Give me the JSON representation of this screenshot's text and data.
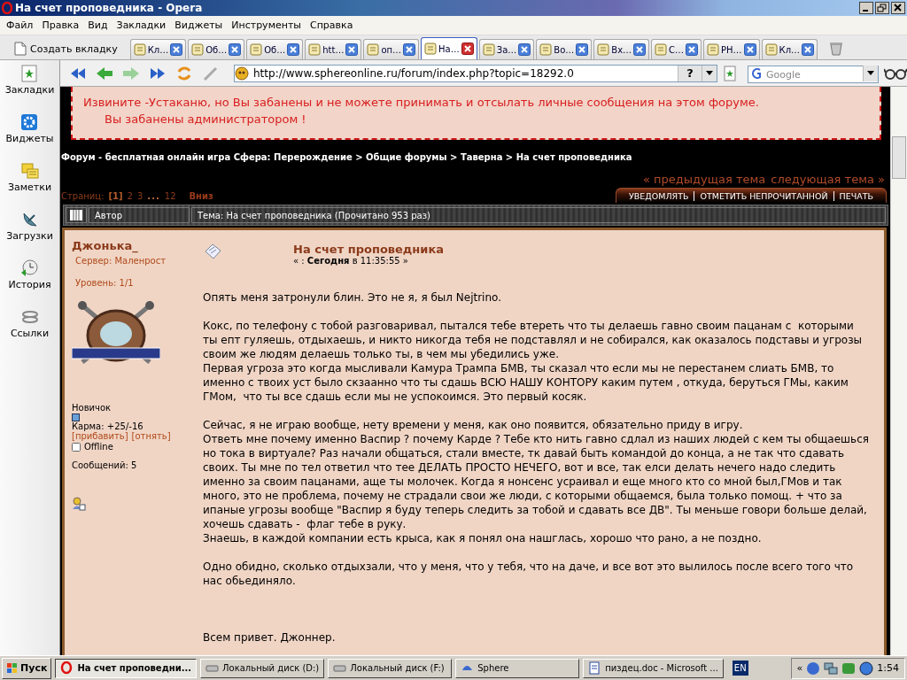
{
  "window": {
    "title": "На счет проповедника - Opera"
  },
  "menu": [
    "Файл",
    "Правка",
    "Вид",
    "Закладки",
    "Виджеты",
    "Инструменты",
    "Справка"
  ],
  "new_tab": "Создать вкладку",
  "tabs": [
    {
      "label": "Кл…",
      "selected": false
    },
    {
      "label": "Об…",
      "selected": false
    },
    {
      "label": "Об…",
      "selected": false
    },
    {
      "label": "htt…",
      "selected": false
    },
    {
      "label": "оп…",
      "selected": false
    },
    {
      "label": "На…",
      "selected": true
    },
    {
      "label": "За…",
      "selected": false
    },
    {
      "label": "Во…",
      "selected": false
    },
    {
      "label": "Вх…",
      "selected": false
    },
    {
      "label": "С…",
      "selected": false
    },
    {
      "label": "PH…",
      "selected": false
    },
    {
      "label": "Кл…",
      "selected": false
    }
  ],
  "address": "http://www.sphereonline.ru/forum/index.php?topic=18292.0",
  "address_help": "?",
  "search": {
    "placeholder": "Google"
  },
  "sidebar": {
    "items": [
      "Закладки",
      "Виджеты",
      "Заметки",
      "Загрузки",
      "История",
      "Ссылки"
    ]
  },
  "forum": {
    "ban_notice": [
      "Извините -Устаканю, но Вы забанены и не можете принимать и отсылать личные сообщения на этом форуме.",
      "Вы забанены администратором !"
    ],
    "breadcrumb": "Форум - бесплатная онлайн игра Сфера: Перерождение > Общие форумы > Таверна > На счет проповедника",
    "topic_nav": [
      "« предыдущая тема",
      "следующая тема »"
    ],
    "pages_label": "Страниц:",
    "pages": [
      {
        "label": "[1]",
        "kind": "page",
        "selected": true
      },
      {
        "label": "2",
        "kind": "page",
        "selected": false
      },
      {
        "label": "3",
        "kind": "page",
        "selected": false
      },
      {
        "label": "...",
        "kind": "gap",
        "selected": false
      },
      {
        "label": "12",
        "kind": "page",
        "selected": false
      }
    ],
    "go_down": "Вниз",
    "actions": [
      "УВЕДОМЛЯТЬ",
      "ОТМЕТИТЬ НЕПРОЧИТАННОЙ",
      "ПЕЧАТЬ"
    ],
    "header": {
      "author": "Автор",
      "topic": "Тема: На счет проповедника  (Прочитано 953 раз)"
    },
    "post": {
      "author": "Джонька_",
      "server": "Сервер: Маленрост",
      "level": "Уровень: 1/1",
      "rank": "Новичок",
      "karma": "Карма: +25/-16",
      "karma_links": [
        "[прибавить]",
        "[отнять]"
      ],
      "status": "Offline",
      "posts": "Сообщений: 5",
      "title": "На счет проповедника",
      "date": "« : **Сегодня** в 11:35:55 »",
      "paragraphs": [
        "Опять меня затронули блин. Это не я, я был Nejtrino.",
        "Кокс, по телефону с тобой разговаривал, пытался тебе втереть что ты делаешь гавно своим пацанам с  которыми\nты епт гуляешь, отдыхаешь, и никто никогда тебя не подставлял и не собирался, как оказалось подставы и угрозы\nсвоим же людям делаешь только ты, в чем мы убедились уже.\nПервая угроза это когда мысливали Камура Трампа БМВ, ты сказал что если мы не перестанем слиать БМВ, то\nименно с твоих уст было скзаанно что ты сдашь ВСЮ НАШУ КОНТОРУ каким путем , откуда, беруться ГМы, каким\nГМом,  что ты все сдашь если мы не успокоимся. Это первый косяк.",
        "Сейчас, я не играю вообще, нету времени у меня, как оно появится, обязательно приду в игру.\nОтветь мне почему именно Васпир ? почему Карде ? Тебе кто нить гавно сдлал из наших людей с кем ты общаешься\nно тока в виртуале? Раз начали общаться, стали вместе, тк давай быть командой до конца, а не так что сдавать\nсвоих. Ты мне по тел ответил что тее ДЕЛАТЬ ПРОСТО НЕЧЕГО, вот и все, так елси делать нечего надо следить\nименно за своим пацанами, аще ты молочек. Когда я нонсенс усраивал и еще много кто со мной был,ГМов и так\nмного, это не проблема, почему не страдали свои же люди, с которыми общаемся, была только помощ. + что за\nипаные угрозы вообще \"Васпир я буду теперь следить за тобой и сдавать все ДВ\". Ты меньше говори больше делай,\nхочешь сдавать -  флаг тебе в руку.\nЗнаешь, в каждой компании есть крыса, как я понял она нашглась, хорошо что рано, а не поздно.",
        "Одно обидно, сколько отдыхзали, что у меня, что у тебя, что на даче, и все вот это вылилось после всего того что\nнас обьединяло.",
        "Всем привет. Джоннер."
      ]
    }
  },
  "taskbar": {
    "start": "Пуск",
    "tasks": [
      {
        "label": "На счет проповедни...",
        "selected": true
      },
      {
        "label": "Локальный диск (D:)",
        "selected": false
      },
      {
        "label": "Локальный диск (F:)",
        "selected": false
      },
      {
        "label": "Sphere",
        "selected": false
      },
      {
        "label": "пиздец.doc - Microsoft ...",
        "selected": false
      }
    ],
    "language": "EN",
    "tray_expand": "«",
    "clock": "1:54"
  }
}
